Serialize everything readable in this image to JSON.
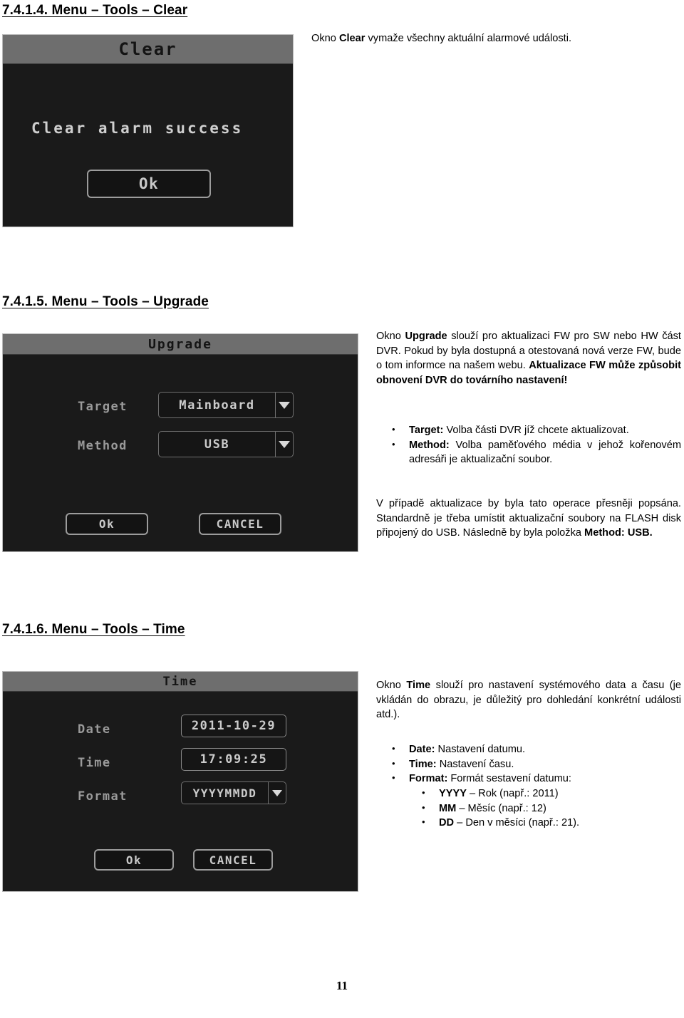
{
  "page": {
    "number": "11"
  },
  "sections": [
    {
      "heading": "7.4.1.4. Menu – Tools – Clear",
      "dialog": {
        "title": "Clear",
        "message": "Clear alarm success",
        "ok_label": "Ok"
      },
      "intro": {
        "prefix": "Okno ",
        "bold": "Clear",
        "suffix": " vymaže všechny aktuální alarmové události."
      }
    },
    {
      "heading": "7.4.1.5. Menu – Tools – Upgrade",
      "dialog": {
        "title": "Upgrade",
        "fields": [
          {
            "label": "Target",
            "value": "Mainboard",
            "type": "combo"
          },
          {
            "label": "Method",
            "value": "USB",
            "type": "combo"
          }
        ],
        "ok_label": "Ok",
        "cancel_label": "CANCEL"
      },
      "intro": {
        "p1_a": "Okno ",
        "p1_b": "Upgrade",
        "p1_c": " slouží pro aktualizaci FW pro SW nebo HW část DVR. Pokud by byla dostupná a otestovaná nová verze FW, bude o tom informce na našem webu. ",
        "p1_d": "Aktualizace FW může způsobit obnovení DVR do továrního nastavení!"
      },
      "bullets": [
        {
          "bold": "Target:",
          "text": " Volba části DVR jíž chcete aktualizovat."
        },
        {
          "bold": "Method:",
          "text": " Volba paměťového média v jehož kořenovém adresáři je aktualizační soubor."
        }
      ],
      "outro": {
        "a": "V případě aktualizace by byla tato operace přesněji popsána. Standardně je třeba umístit aktualizační soubory na FLASH disk připojený do USB. Následně by byla položka ",
        "b": "Method: USB."
      }
    },
    {
      "heading": "7.4.1.6. Menu – Tools – Time",
      "dialog": {
        "title": "Time",
        "fields": [
          {
            "label": "Date",
            "value": "2011-10-29",
            "type": "text"
          },
          {
            "label": "Time",
            "value": "17:09:25",
            "type": "text"
          },
          {
            "label": "Format",
            "value": "YYYYMMDD",
            "type": "combo"
          }
        ],
        "ok_label": "Ok",
        "cancel_label": "CANCEL"
      },
      "intro": {
        "a": "Okno  ",
        "b": "Time",
        "c": " slouží pro nastavení systémového data a času (je vkládán do obrazu, je důležitý pro dohledání konkrétní události atd.)."
      },
      "bullets": [
        {
          "bold": "Date:",
          "text": " Nastavení datumu."
        },
        {
          "bold": "Time:",
          "text": " Nastavení času."
        },
        {
          "bold": "Format:",
          "text": " Formát sestavení datumu:"
        }
      ],
      "subbullets": [
        {
          "bold": "YYYY",
          "text": " – Rok (např.: 2011)"
        },
        {
          "bold": "MM",
          "text": " – Měsíc (např.: 12)"
        },
        {
          "bold": "DD",
          "text": " – Den v měsíci (např.: 21)."
        }
      ]
    }
  ]
}
